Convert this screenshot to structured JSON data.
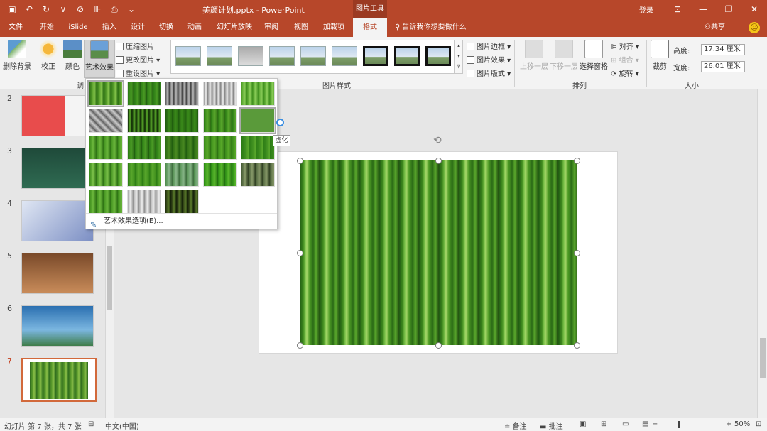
{
  "titlebar": {
    "doc_title": "美颜计划.pptx  -  PowerPoint",
    "tools_tab": "图片工具",
    "login": "登录",
    "qat_icons": [
      "save-icon",
      "undo-icon",
      "redo-icon",
      "format-painter-icon",
      "touch-mode-icon",
      "align-icon",
      "print-icon",
      "more-icon"
    ]
  },
  "tabs": [
    {
      "label": "文件"
    },
    {
      "label": "开始"
    },
    {
      "label": "iSlide"
    },
    {
      "label": "插入"
    },
    {
      "label": "设计"
    },
    {
      "label": "切换"
    },
    {
      "label": "动画"
    },
    {
      "label": "幻灯片放映"
    },
    {
      "label": "审阅"
    },
    {
      "label": "视图"
    },
    {
      "label": "加载项"
    },
    {
      "label": "格式"
    }
  ],
  "tellme": "告诉我你想要做什么",
  "share": "共享",
  "ribbon": {
    "remove_bg": "删除背景",
    "correct": "校正",
    "color": "颜色",
    "art_effects": "艺术效果",
    "compress": "压缩图片",
    "change": "更改图片",
    "reset": "重设图片",
    "adjust_group": "调",
    "styles_group": "图片样式",
    "border": "图片边框",
    "effects": "图片效果",
    "layout": "图片版式",
    "bring_forward": "上移一层",
    "send_backward": "下移一层",
    "selection_pane": "选择窗格",
    "align": "对齐",
    "group": "组合",
    "rotate": "旋转",
    "arrange_group": "排列",
    "crop": "裁剪",
    "height_label": "高度:",
    "height_value": "17.34 厘米",
    "width_label": "宽度:",
    "width_value": "26.01 厘米",
    "size_group": "大小"
  },
  "slides": [
    {
      "num": "2"
    },
    {
      "num": "3"
    },
    {
      "num": "4"
    },
    {
      "num": "5"
    },
    {
      "num": "6"
    },
    {
      "num": "7"
    }
  ],
  "art_menu": {
    "footer": "艺术效果选项(E)...",
    "tooltip": "虚化"
  },
  "statusbar": {
    "slide_info": "幻灯片 第 7 张，共 7 张",
    "language": "中文(中国)",
    "notes": "备注",
    "comments": "批注",
    "zoom": "50%"
  },
  "colors": {
    "accent": "#b7472a",
    "ribbon_bg": "#f3f3f3",
    "selected_slide_border": "#d2693b"
  }
}
